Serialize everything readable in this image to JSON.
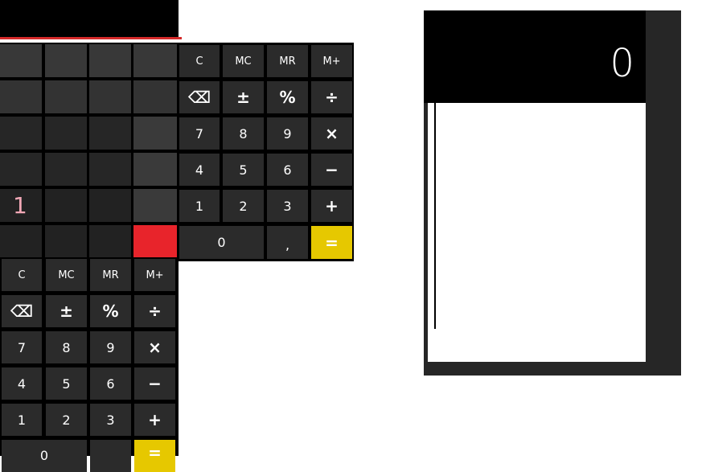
{
  "colors": {
    "key_dark": "#2b2b2b",
    "key_mid": "#3a3a3a",
    "key_equals": "#e6c800",
    "accent_red": "#e8242b",
    "highlight_text": "#f2a8b6",
    "window_frame": "#262626"
  },
  "keypad": {
    "row1": [
      "C",
      "MC",
      "MR",
      "M+"
    ],
    "row2": [
      "⌫",
      "±",
      "%",
      "÷"
    ],
    "row3": [
      "7",
      "8",
      "9",
      "×"
    ],
    "row4": [
      "4",
      "5",
      "6",
      "−"
    ],
    "row5": [
      "1",
      "2",
      "3",
      "+"
    ],
    "zero": "0",
    "decimal": ",",
    "equals": "="
  },
  "programmer_grid": {
    "value_label": "1"
  },
  "window": {
    "display_value": "0"
  }
}
